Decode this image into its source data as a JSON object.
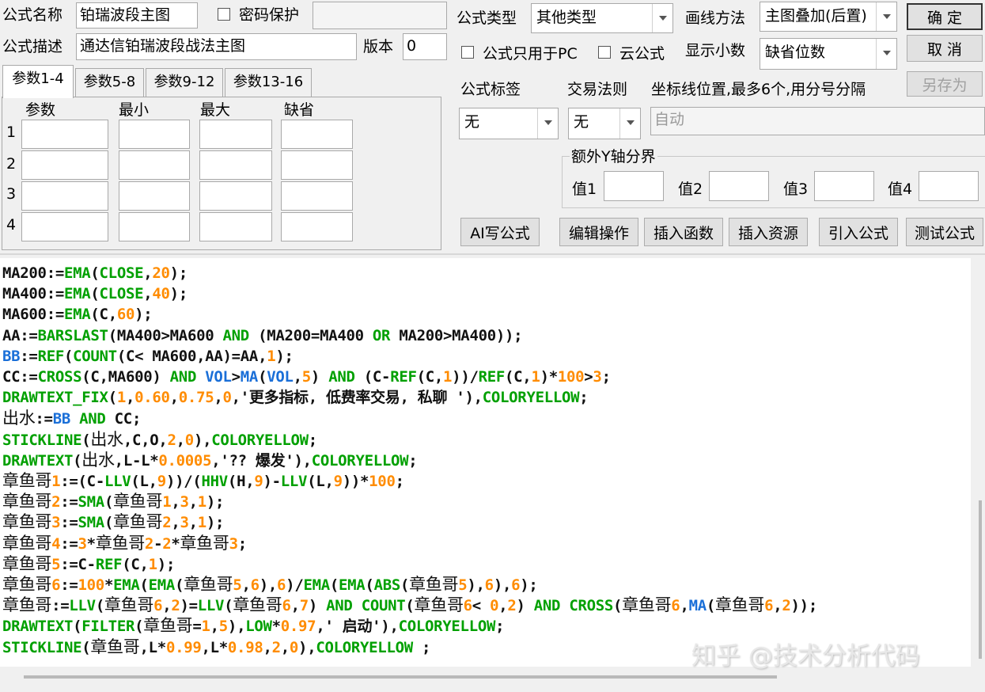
{
  "top": {
    "formula_name_label": "公式名称",
    "formula_name_value": "铂瑞波段主图",
    "password_label": "密码保护",
    "formula_desc_label": "公式描述",
    "formula_desc_value": "通达信铂瑞波段战法主图",
    "version_label": "版本",
    "version_value": "0",
    "formula_type_label": "公式类型",
    "formula_type_value": "其他类型",
    "draw_method_label": "画线方法",
    "draw_method_value": "主图叠加(后置)",
    "pc_only_label": "公式只用于PC",
    "cloud_label": "云公式",
    "decimals_label": "显示小数",
    "decimals_value": "缺省位数",
    "ok_button": "确  定",
    "cancel_button": "取  消",
    "save_as_button": "另存为"
  },
  "params": {
    "tabs": [
      "参数1-4",
      "参数5-8",
      "参数9-12",
      "参数13-16"
    ],
    "columns": [
      "参数",
      "最小",
      "最大",
      "缺省"
    ],
    "rows": [
      "1",
      "2",
      "3",
      "4"
    ]
  },
  "right": {
    "tag_label": "公式标签",
    "tag_value": "无",
    "rule_label": "交易法则",
    "rule_value": "无",
    "axis_label": "坐标线位置,最多6个,用分号分隔",
    "axis_placeholder": "自动",
    "y_group_title": "额外Y轴分界",
    "y_values": [
      "值1",
      "值2",
      "值3",
      "值4"
    ]
  },
  "toolbar": [
    "AI写公式",
    "编辑操作",
    "插入函数",
    "插入资源",
    "引入公式",
    "测试公式"
  ],
  "code_lines": [
    "MA200:=EMA(CLOSE,20);",
    "MA400:=EMA(CLOSE,40);",
    "MA600:=EMA(C,60);",
    "AA:=BARSLAST(MA400>MA600 AND (MA200=MA400 OR MA200>MA400));",
    "BB:=REF(COUNT(C< MA600,AA)=AA,1);",
    "CC:=CROSS(C,MA600) AND VOL>MA(VOL,5) AND (C-REF(C,1))/REF(C,1)*100>3;",
    "DRAWTEXT_FIX(1,0.60,0.75,0,'更多指标, 低费率交易, 私聊 '),COLORYELLOW;",
    "出水:=BB AND CC;",
    "STICKLINE(出水,C,O,2,0),COLORYELLOW;",
    "DRAWTEXT(出水,L-L*0.0005,'?? 爆发'),COLORYELLOW;",
    "章鱼哥1:=(C-LLV(L,9))/(HHV(H,9)-LLV(L,9))*100;",
    "章鱼哥2:=SMA(章鱼哥1,3,1);",
    "章鱼哥3:=SMA(章鱼哥2,3,1);",
    "章鱼哥4:=3*章鱼哥2-2*章鱼哥3;",
    "章鱼哥5:=C-REF(C,1);",
    "章鱼哥6:=100*EMA(EMA(章鱼哥5,6),6)/EMA(EMA(ABS(章鱼哥5),6),6);",
    "章鱼哥:=LLV(章鱼哥6,2)=LLV(章鱼哥6,7) AND COUNT(章鱼哥6< 0,2) AND CROSS(章鱼哥6,MA(章鱼哥6,2));",
    "DRAWTEXT(FILTER(章鱼哥=1,5),LOW*0.97,' 启动'),COLORYELLOW;",
    "STICKLINE(章鱼哥,L*0.99,L*0.98,2,0),COLORYELLOW ;"
  ],
  "watermark": "知乎 @技术分析代码",
  "colors": {
    "function": "#00a000",
    "keyword": "#00a000",
    "variable": "#1a6fd8",
    "number": "#ff8c00"
  }
}
